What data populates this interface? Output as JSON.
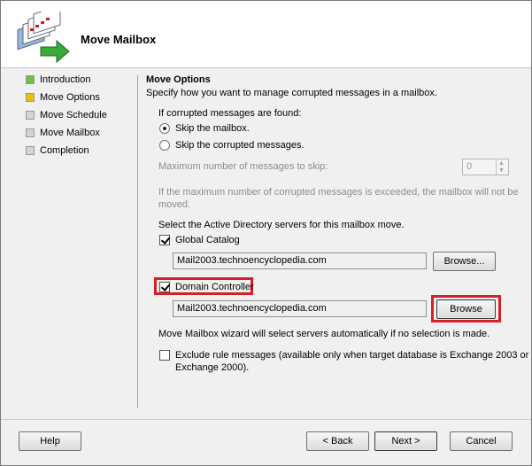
{
  "header": {
    "title": "Move Mailbox",
    "icon": "move-mailbox-wizard-icon"
  },
  "nav": {
    "items": [
      {
        "label": "Introduction",
        "state": "complete",
        "color": "#6cc04a"
      },
      {
        "label": "Move Options",
        "state": "current",
        "color": "#e8c400"
      },
      {
        "label": "Move Schedule",
        "state": "pending",
        "color": "#d4d4d4"
      },
      {
        "label": "Move Mailbox",
        "state": "pending",
        "color": "#d4d4d4"
      },
      {
        "label": "Completion",
        "state": "pending",
        "color": "#d4d4d4"
      }
    ]
  },
  "options": {
    "title": "Move Options",
    "description": "Specify how you want to manage corrupted messages in a mailbox.",
    "corrupted_label": "If corrupted messages are found:",
    "skip_mailbox": "Skip the mailbox.",
    "skip_messages": "Skip the corrupted messages.",
    "selected": "skip_mailbox",
    "max_label": "Maximum number of messages to skip:",
    "max_value": "0",
    "exceeded_note_line1": "If the maximum number of corrupted messages is exceeded, the mailbox will not be",
    "exceeded_note_line2": "moved.",
    "ad_label": "Select the Active Directory servers for this mailbox move.",
    "global_catalog": {
      "label": "Global Catalog",
      "checked": true,
      "value": "Mail2003.technoencyclopedia.com",
      "browse": "Browse..."
    },
    "domain_controller": {
      "label": "Domain Controller",
      "checked": true,
      "value": "Mail2003.technoencyclopedia.com",
      "browse": "Browse"
    },
    "auto_note": "Move Mailbox wizard will select servers automatically if no selection is made.",
    "exclude_line1": "Exclude rule messages (available only when target database is Exchange 2003 or",
    "exclude_line2": "Exchange 2000).",
    "exclude_checked": false
  },
  "footer": {
    "help": "Help",
    "back": "< Back",
    "next": "Next >",
    "cancel": "Cancel"
  },
  "highlight_color": "#d61f27"
}
